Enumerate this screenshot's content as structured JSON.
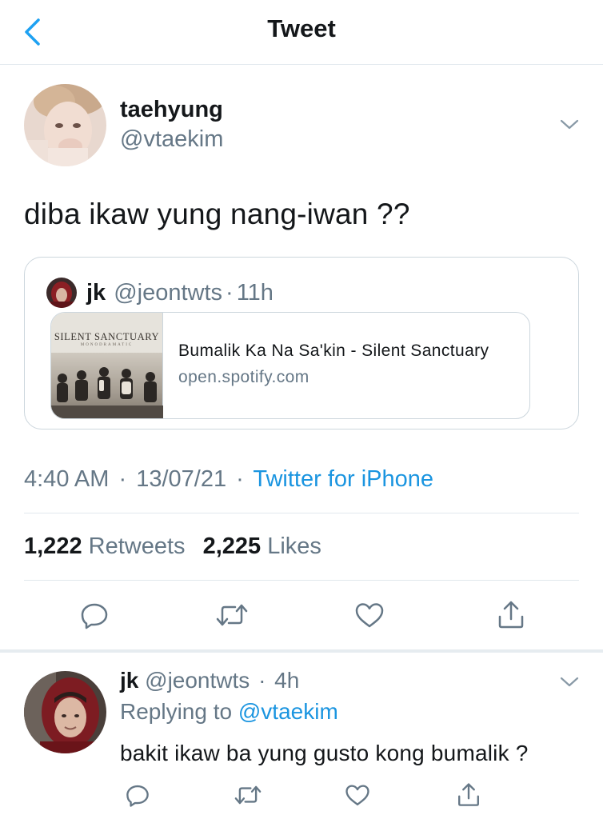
{
  "header": {
    "title": "Tweet",
    "back_icon": "chevron-left-icon",
    "accent_color": "#1da1f2"
  },
  "tweet": {
    "author_name": "taehyung",
    "author_handle": "@vtaekim",
    "text": "diba ikaw yung nang-iwan ??",
    "quoted": {
      "author_name": "jk",
      "author_handle": "@jeontwts",
      "separator": "·",
      "time": "11h",
      "link_card": {
        "thumbnail_logo": "SILENT SANCTUARY",
        "thumbnail_sub": "MONODRAMATIC",
        "title": "Bumalik Ka Na Sa'kin - Silent Sanctuary",
        "domain": "open.spotify.com"
      }
    },
    "time": "4:40 AM",
    "date": "13/07/21",
    "separator": "·",
    "source": "Twitter for iPhone",
    "stats": {
      "retweets_count": "1,222",
      "retweets_label": "Retweets",
      "likes_count": "2,225",
      "likes_label": "Likes"
    },
    "actions": [
      "reply-icon",
      "retweet-icon",
      "like-icon",
      "share-icon"
    ]
  },
  "reply": {
    "author_name": "jk",
    "author_handle": "@jeontwts",
    "separator": "·",
    "time": "4h",
    "replying_to_label": "Replying to",
    "replying_to_handle": "@vtaekim",
    "text": "bakit ikaw ba yung gusto kong bumalik ?",
    "actions": [
      "reply-icon",
      "retweet-icon",
      "like-icon",
      "share-icon"
    ]
  },
  "colors": {
    "link_blue": "#1b95e0",
    "muted_gray": "#657786",
    "text_black": "#14171a",
    "border": "#e1e8ed"
  }
}
